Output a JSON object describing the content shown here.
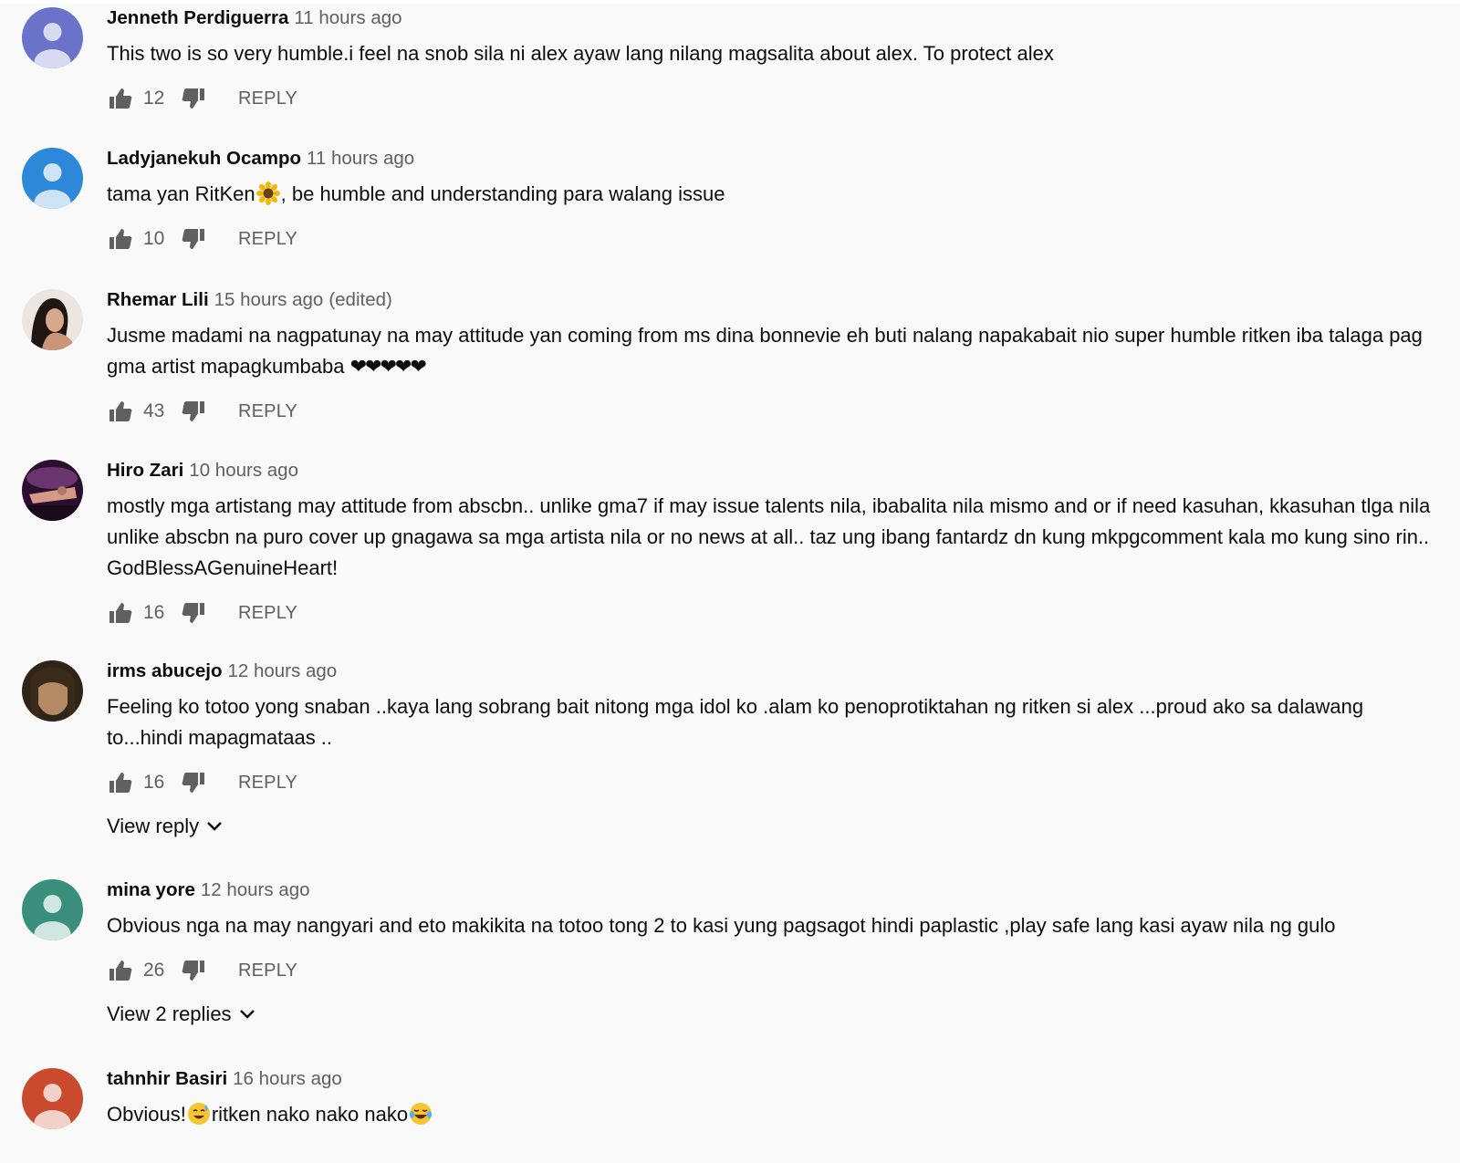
{
  "actions": {
    "reply_label": "REPLY"
  },
  "comments": [
    {
      "author": "Jenneth Perdiguerra",
      "time": "11 hours ago",
      "text": "This two is so very humble.i feel na snob sila ni alex ayaw lang nilang magsalita about alex. To protect alex",
      "likes": "12",
      "avatar_color": "#6b72c9"
    },
    {
      "author": "Ladyjanekuh Ocampo",
      "time": "11 hours ago",
      "text_before": "tama yan RitKen",
      "emoji": "sunflower",
      "text_after": ", be humble and understanding para walang issue",
      "likes": "10",
      "avatar_color": "#2e88d9"
    },
    {
      "author": "Rhemar Lili",
      "time": "15 hours ago",
      "edited": "(edited)",
      "text": "Jusme madami na nagpatunay na may attitude yan coming from ms dina bonnevie eh buti nalang napakabait nio super humble ritken iba talaga pag gma artist mapagkumbaba",
      "hearts": "❤❤❤❤❤",
      "likes": "43",
      "avatar_color": "#d9c3b5"
    },
    {
      "author": "Hiro Zari",
      "time": "10 hours ago",
      "text": "mostly mga artistang may attitude from abscbn.. unlike gma7 if may issue talents nila, ibabalita nila mismo and or if need kasuhan, kkasuhan tlga nila unlike abscbn na puro cover up gnagawa sa mga artista nila or no news at all.. taz ung ibang fantardz dn kung mkpgcomment kala mo kung sino rin.. GodBlessAGenuineHeart!",
      "likes": "16",
      "avatar_color": "#3a1a3f"
    },
    {
      "author": "irms abucejo",
      "time": "12 hours ago",
      "text": "Feeling ko totoo yong snaban ..kaya lang sobrang bait nitong mga idol ko .alam ko penoprotiktahan ng ritken si alex ...proud ako sa dalawang to...hindi mapagmataas ..",
      "likes": "16",
      "view_replies": "View reply",
      "avatar_color": "#5a4632"
    },
    {
      "author": "mina yore",
      "time": "12 hours ago",
      "text": "Obvious nga na may nangyari and eto makikita na totoo tong 2 to kasi yung pagsagot hindi paplastic ,play safe lang kasi ayaw nila ng gulo",
      "likes": "26",
      "view_replies": "View 2 replies",
      "avatar_color": "#3a8f7c"
    },
    {
      "author": "tahnhir Basiri",
      "time": "16 hours ago",
      "text_before": "Obvious!",
      "emoji": "grinning-sweat",
      "text_middle": "ritken nako nako nako",
      "emoji2": "tears-of-joy",
      "avatar_color": "#c94a2c"
    }
  ]
}
